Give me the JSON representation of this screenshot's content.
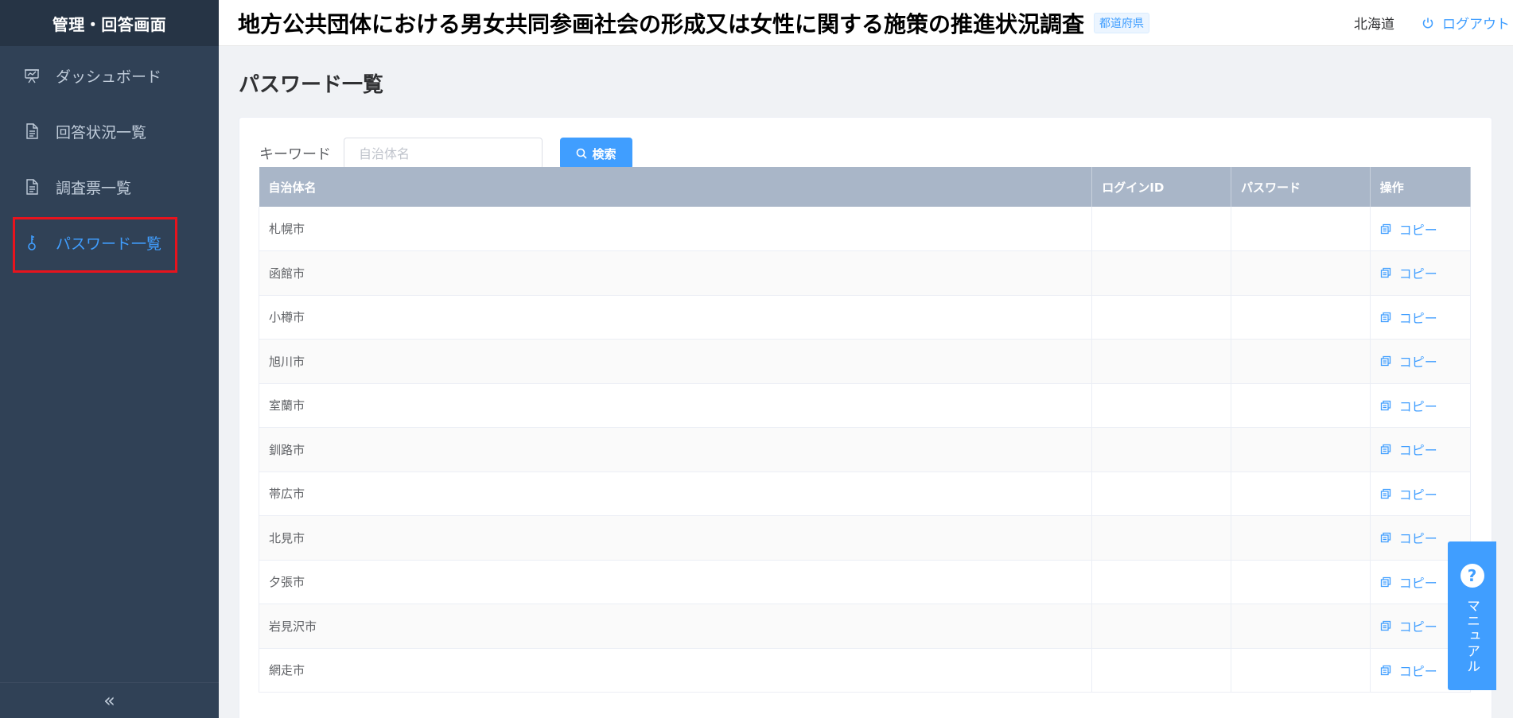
{
  "sidebar": {
    "title": "管理・回答画面",
    "items": [
      {
        "label": "ダッシュボード",
        "icon": "presentation-icon",
        "active": false
      },
      {
        "label": "回答状況一覧",
        "icon": "document-icon",
        "active": false
      },
      {
        "label": "調査票一覧",
        "icon": "document-icon",
        "active": false
      },
      {
        "label": "パスワード一覧",
        "icon": "key-icon",
        "active": true
      }
    ],
    "collapse_icon": "«"
  },
  "header": {
    "title": "地方公共団体における男女共同参画社会の形成又は女性に関する施策の推進状況調査",
    "tag": "都道府県",
    "prefecture": "北海道",
    "logout_label": "ログアウト"
  },
  "main": {
    "page_title": "パスワード一覧",
    "search": {
      "label": "キーワード",
      "placeholder": "自治体名",
      "value": "",
      "button_label": "検索"
    },
    "table": {
      "columns": [
        "自治体名",
        "ログインID",
        "パスワード",
        "操作"
      ],
      "rows": [
        {
          "name": "札幌市",
          "login_id": "",
          "password": "",
          "action": "コピー"
        },
        {
          "name": "函館市",
          "login_id": "",
          "password": "",
          "action": "コピー"
        },
        {
          "name": "小樽市",
          "login_id": "",
          "password": "",
          "action": "コピー"
        },
        {
          "name": "旭川市",
          "login_id": "",
          "password": "",
          "action": "コピー"
        },
        {
          "name": "室蘭市",
          "login_id": "",
          "password": "",
          "action": "コピー"
        },
        {
          "name": "釧路市",
          "login_id": "",
          "password": "",
          "action": "コピー"
        },
        {
          "name": "帯広市",
          "login_id": "",
          "password": "",
          "action": "コピー"
        },
        {
          "name": "北見市",
          "login_id": "",
          "password": "",
          "action": "コピー"
        },
        {
          "name": "夕張市",
          "login_id": "",
          "password": "",
          "action": "コピー"
        },
        {
          "name": "岩見沢市",
          "login_id": "",
          "password": "",
          "action": "コピー"
        },
        {
          "name": "網走市",
          "login_id": "",
          "password": "",
          "action": "コピー"
        }
      ]
    }
  },
  "manual": {
    "icon": "?",
    "label": "マニュアル"
  },
  "colors": {
    "sidebar_bg": "#304156",
    "accent": "#409eff",
    "highlight_border": "#e8131d",
    "table_header_bg": "#a9b6c8"
  }
}
